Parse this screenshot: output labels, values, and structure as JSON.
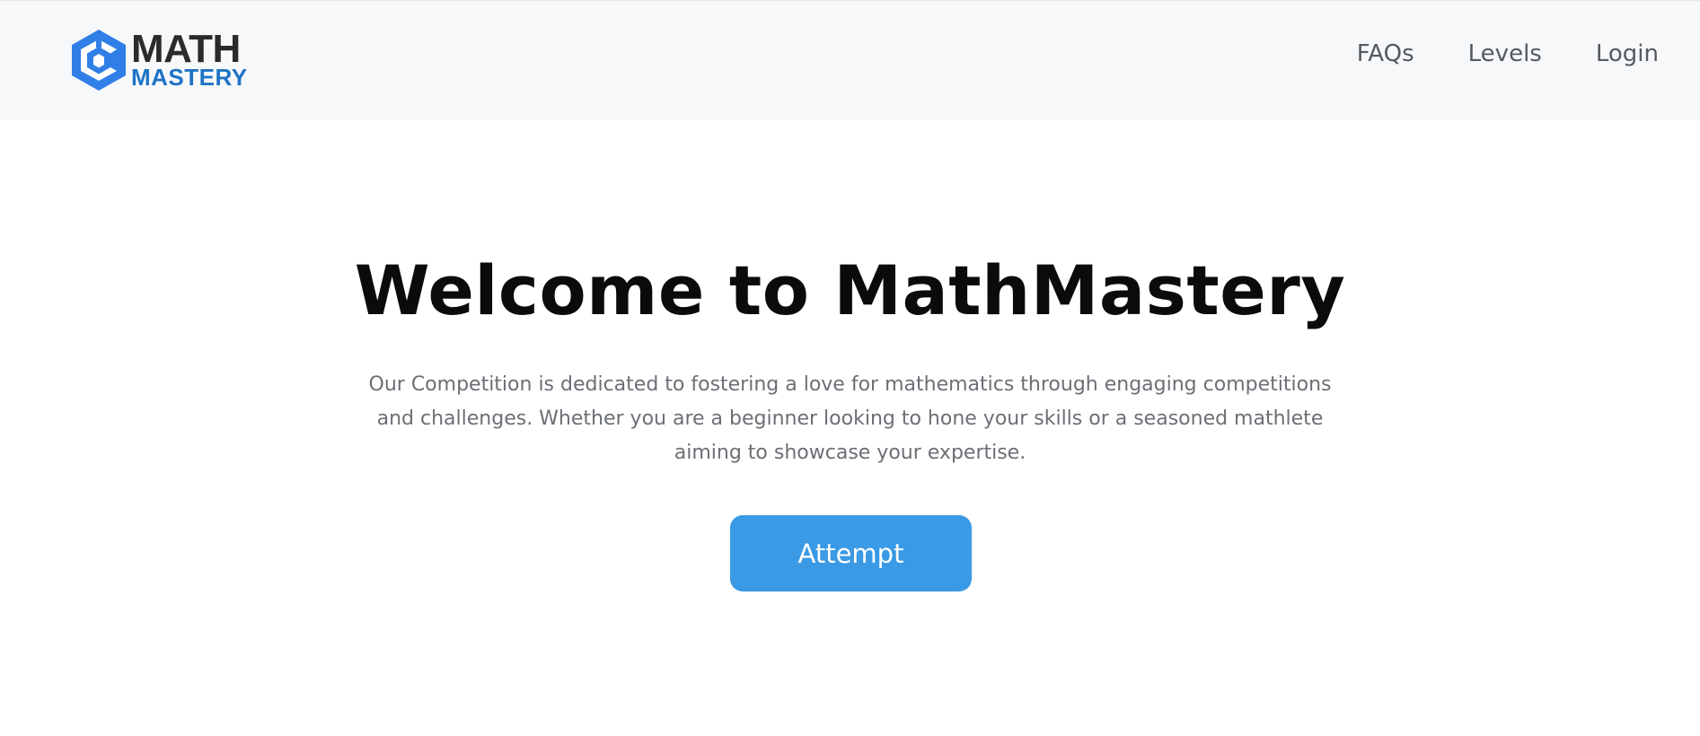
{
  "brand": {
    "name_top": "MATH",
    "name_bottom": "MASTERY",
    "logo_icon": "hexagon-cube-logo-icon",
    "colors": {
      "logo_blue": "#2f7fe6",
      "logo_dark_text": "#2b2b2b",
      "logo_blue_text": "#1e73c6"
    }
  },
  "nav": {
    "items": [
      {
        "label": "FAQs"
      },
      {
        "label": "Levels"
      },
      {
        "label": "Login"
      }
    ]
  },
  "hero": {
    "title": "Welcome to MathMastery",
    "description": "Our Competition is dedicated to fostering a love for mathematics through engaging competitions and challenges. Whether you are a beginner looking to hone your skills or a seasoned mathlete aiming to showcase your expertise.",
    "cta_label": "Attempt",
    "cta_color": "#3a9ae5"
  }
}
